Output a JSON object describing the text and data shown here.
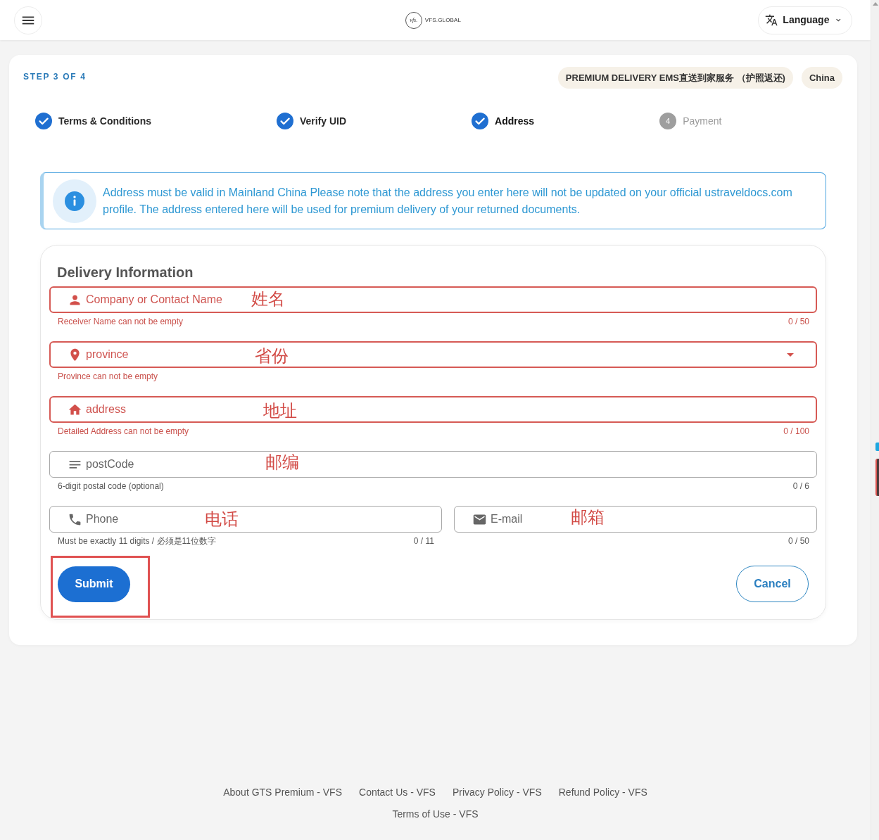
{
  "header": {
    "logo": {
      "mark": "vfs.",
      "name": "VFS.GLOBAL"
    },
    "language_button": {
      "label": "Language"
    }
  },
  "step_indicator": "STEP 3 OF 4",
  "chips": [
    "PREMIUM DELIVERY EMS直送到家服务 （护照返还)",
    "China"
  ],
  "steps": [
    {
      "label": "Terms & Conditions",
      "completed": true,
      "selected": false
    },
    {
      "label": "Verify UID",
      "completed": true,
      "selected": false
    },
    {
      "label": "Address",
      "completed": true,
      "selected": true
    },
    {
      "label": "Payment",
      "number": "4",
      "completed": false,
      "selected": false
    }
  ],
  "alert": {
    "text": "Address must be valid in Mainland China Please note that the address you enter here will not be updated on your official ustraveldocs.com profile. The address entered here will be used for premium delivery of your returned documents."
  },
  "form": {
    "title": "Delivery Information",
    "rows": [
      {
        "fields": [
          {
            "kind": "text",
            "placeholder": "Company or Contact Name",
            "error": true,
            "helper": "Receiver Name can not be empty",
            "counter": "0 / 50",
            "annotation": "姓名"
          }
        ]
      },
      {
        "fields": [
          {
            "kind": "select",
            "placeholder": "province",
            "error": true,
            "helper": "Province can not be empty",
            "annotation": "省份"
          }
        ]
      },
      {
        "fields": [
          {
            "kind": "text",
            "placeholder": "address",
            "error": true,
            "helper": "Detailed Address can not be empty",
            "counter": "0 / 100",
            "annotation": "地址"
          }
        ]
      },
      {
        "fields": [
          {
            "kind": "text",
            "placeholder": "postCode",
            "error": false,
            "helper": "6-digit postal code (optional)",
            "counter": "0 / 6",
            "annotation": "邮编"
          }
        ]
      },
      {
        "fields": [
          {
            "kind": "text",
            "placeholder": "Phone",
            "error": false,
            "helper": "Must be exactly 11 digits / 必须是11位数字",
            "counter": "0 / 11",
            "annotation": "电话"
          },
          {
            "kind": "text",
            "placeholder": "E-mail",
            "error": false,
            "counter": "0 / 50",
            "annotation": "邮箱"
          }
        ]
      }
    ],
    "submit": {
      "label": "Submit",
      "highlighted": true
    },
    "cancel": {
      "label": "Cancel"
    }
  },
  "footer": {
    "rows": [
      {
        "links": [
          "About GTS Premium - VFS",
          "Contact Us - VFS",
          "Privacy Policy - VFS",
          "Refund Policy - VFS"
        ]
      },
      {
        "links": [
          "Terms of Use - VFS"
        ]
      }
    ]
  }
}
